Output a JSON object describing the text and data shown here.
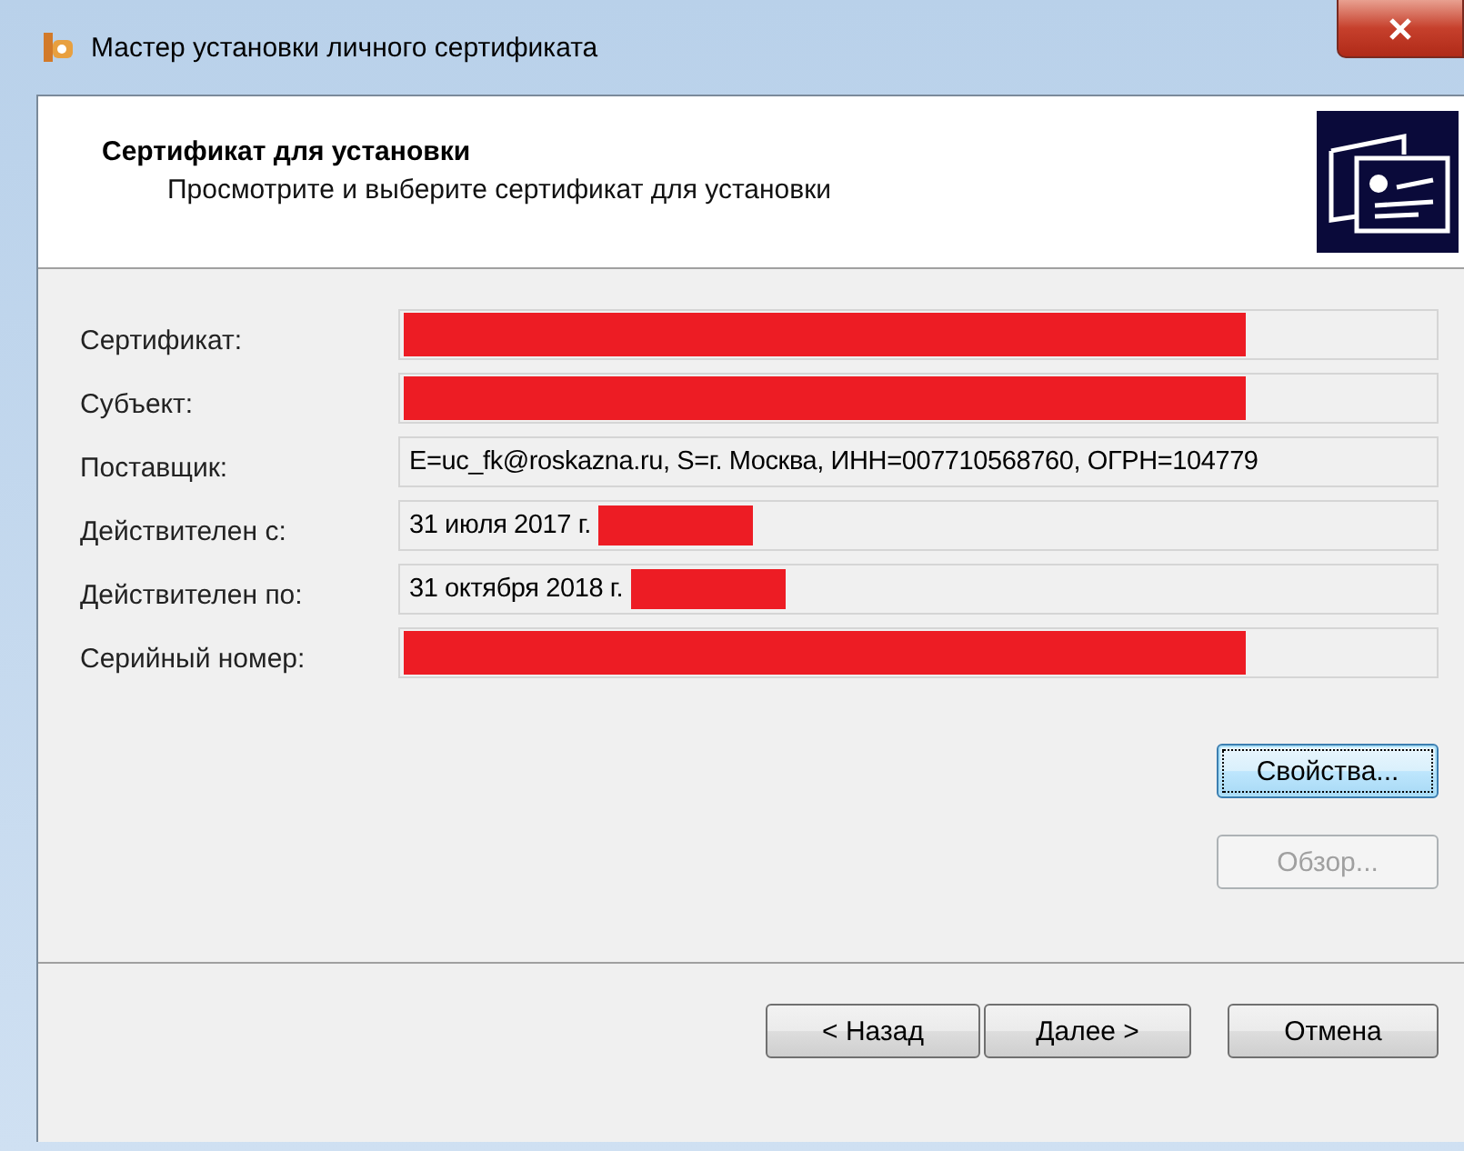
{
  "window": {
    "title": "Мастер установки личного сертификата"
  },
  "header": {
    "title": "Сертификат для установки",
    "subtitle": "Просмотрите и выберите сертификат для установки"
  },
  "fields": [
    {
      "label": "Сертификат:",
      "redacted": true
    },
    {
      "label": "Субъект:",
      "redacted": true
    },
    {
      "label": "Поставщик:",
      "value": "E=uc_fk@roskazna.ru, S=г. Москва, ИНН=007710568760, ОГРН=104779",
      "redacted": false
    },
    {
      "label": "Действителен с:",
      "value": "31 июля 2017 г.",
      "redacted": true
    },
    {
      "label": "Действителен по:",
      "value": "31 октября 2018 г.",
      "redacted": true
    },
    {
      "label": "Серийный номер:",
      "redacted": true
    }
  ],
  "side_buttons": [
    {
      "label": "Свойства...",
      "disabled": false,
      "focused": true
    },
    {
      "label": "Обзор...",
      "disabled": true,
      "focused": false
    }
  ],
  "nav_buttons": [
    {
      "label": "< Назад",
      "kind": "back"
    },
    {
      "label": "Далее >",
      "kind": "next"
    },
    {
      "label": "Отмена",
      "kind": "cancel"
    }
  ]
}
